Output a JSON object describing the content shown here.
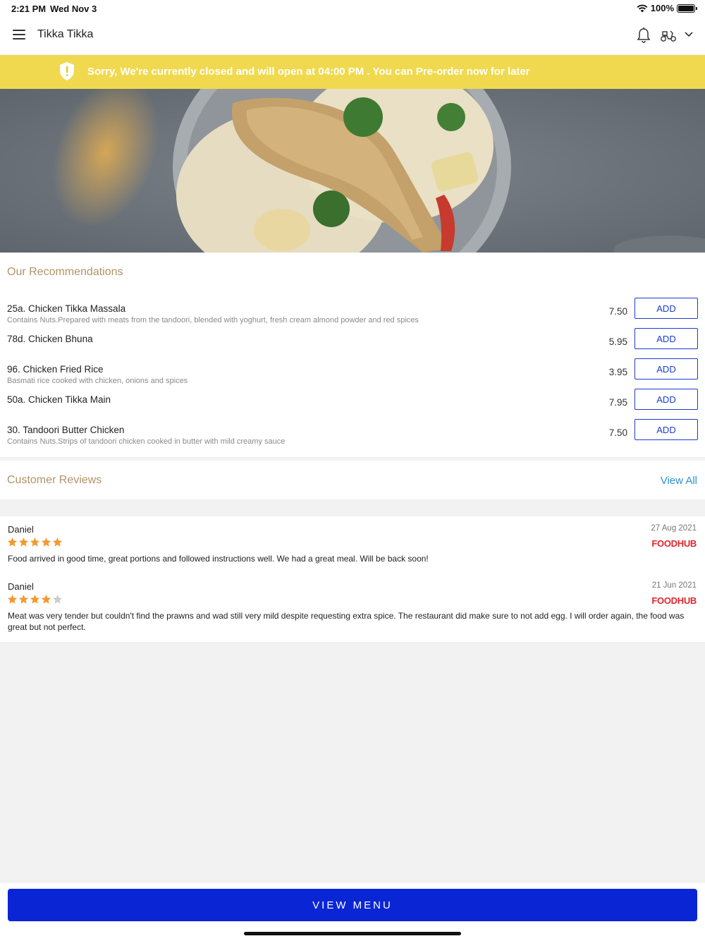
{
  "status_bar": {
    "time": "2:21 PM",
    "date": "Wed Nov 3",
    "battery": "100%"
  },
  "header": {
    "title": "Tikka Tikka",
    "icons": [
      "menu-icon",
      "bell-icon",
      "scooter-icon",
      "chevron-down-icon"
    ]
  },
  "banner": {
    "text": "Sorry, We're currently closed and will open at 04:00 PM . You can Pre-order now for later",
    "color": "#f0d94e"
  },
  "recommendations": {
    "title": "Our Recommendations",
    "items": [
      {
        "name": "25a. Chicken Tikka Massala",
        "description": "Contains Nuts.Prepared with meats from the tandoori, blended with yoghurt, fresh cream almond powder and red spices",
        "price": "7.50",
        "button": "ADD"
      },
      {
        "name": "78d. Chicken Bhuna",
        "description": "",
        "price": "5.95",
        "button": "ADD"
      },
      {
        "name": "96. Chicken Fried Rice",
        "description": "Basmati rice cooked with chicken, onions and spices",
        "price": "3.95",
        "button": "ADD"
      },
      {
        "name": "50a. Chicken Tikka Main",
        "description": "",
        "price": "7.95",
        "button": "ADD"
      },
      {
        "name": "30. Tandoori Butter Chicken",
        "description": "Contains Nuts.Strips of tandoori chicken cooked in butter with mild creamy sauce",
        "price": "7.50",
        "button": "ADD"
      }
    ]
  },
  "reviews": {
    "title": "Customer Reviews",
    "view_all": "View All",
    "items": [
      {
        "name": "Daniel",
        "date": "27 Aug 2021",
        "rating": 5,
        "source": "FOODHUB",
        "text": "Food arrived in good time, great portions and followed instructions well. We had a great meal. Will be back soon!"
      },
      {
        "name": "Daniel",
        "date": "21 Jun 2021",
        "rating": 4,
        "source": "FOODHUB",
        "text": "Meat was very tender but couldn't find the prawns and wad still very mild despite requesting extra spice. The restaurant did make sure to not add egg. I will order again, the food was great but not perfect."
      }
    ]
  },
  "footer": {
    "button": "VIEW MENU",
    "color": "#0a26d4"
  },
  "colors": {
    "accent_text": "#b39366",
    "link": "#2d8fd5",
    "add_button": "#1a3bcf",
    "star": "#f29a2e",
    "star_empty": "#cccccc",
    "foodhub": "#e0262b"
  }
}
